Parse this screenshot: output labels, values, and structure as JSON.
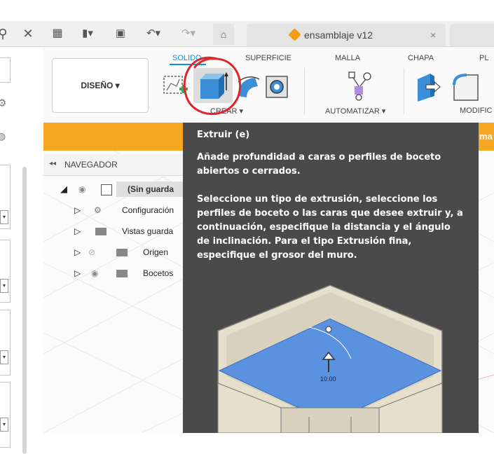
{
  "tabbar": {
    "document_title": "ensamblaje v12",
    "close_glyph": "×"
  },
  "toolbar": {
    "design_button": "DISEÑO ▾",
    "workspace_tabs": [
      "SOLIDO",
      "SUPERFICIE",
      "MALLA",
      "CHAPA",
      "PL"
    ],
    "groups": [
      "CREAR ▾",
      "AUTOMATIZAR ▾",
      "MODIFIC"
    ],
    "accent_color": "#0696d7"
  },
  "banner": {
    "text": "ma",
    "color": "#f5a623"
  },
  "navigator": {
    "header": "NAVEGADOR",
    "root": "(Sin guarda",
    "items": [
      "Configuración",
      "Vistas guarda",
      "Origen",
      "Bocetos"
    ]
  },
  "tooltip": {
    "title": "Extruir (e)",
    "summary": "Añade profundidad a caras o perfiles de boceto abiertos o cerrados.",
    "details": "Seleccione un tipo de extrusión, seleccione los perfiles de boceto o las caras que desee extruir y, a continuación, especifique la distancia y el ángulo de inclinación. Para el tipo Extrusión fina, especifique el grosor del muro.",
    "illustration_value": "10.00"
  },
  "annotation": {
    "color": "#e0262a"
  }
}
